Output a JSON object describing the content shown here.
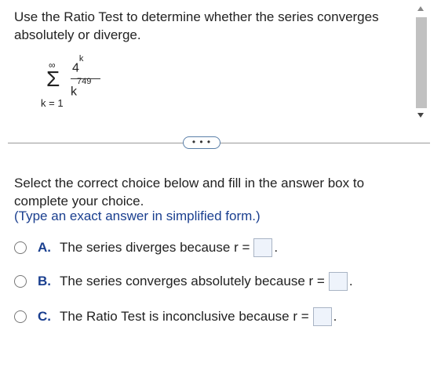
{
  "question": {
    "prompt": "Use the Ratio Test to determine whether the series converges absolutely or diverge.",
    "series": {
      "upper_limit": "∞",
      "sigma": "Σ",
      "lower_limit": "k = 1",
      "numerator_base": "4",
      "numerator_exp": "k",
      "denominator_base": "k",
      "denominator_exp": "749"
    }
  },
  "more_button": "• • •",
  "instructions": "Select the correct choice below and fill in the answer box to complete your choice.",
  "hint": "(Type an exact answer in simplified form.)",
  "choices": [
    {
      "letter": "A.",
      "text": "The series diverges because r =",
      "answer": ""
    },
    {
      "letter": "B.",
      "text": "The series converges absolutely because r =",
      "answer": ""
    },
    {
      "letter": "C.",
      "text": "The Ratio Test is inconclusive because r =",
      "answer": ""
    }
  ],
  "period": "."
}
